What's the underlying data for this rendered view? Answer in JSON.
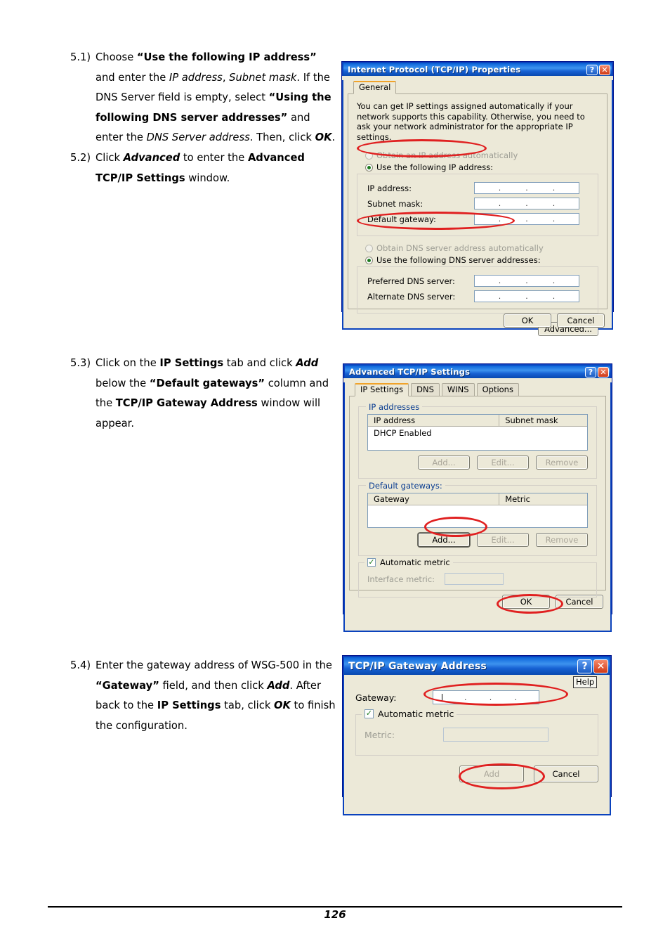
{
  "steps": [
    {
      "num": "5.1)",
      "id": "step-5-1",
      "segments": [
        {
          "t": "Choose ",
          "s": "n"
        },
        {
          "t": "“Use the following IP address”",
          "s": "b"
        },
        {
          "t": " and enter the ",
          "s": "n"
        },
        {
          "t": "IP address",
          "s": "i"
        },
        {
          "t": ", ",
          "s": "n"
        },
        {
          "t": "Subnet mask",
          "s": "i"
        },
        {
          "t": ". If the DNS Server field is empty, select ",
          "s": "n"
        },
        {
          "t": "“Using the following DNS server addresses”",
          "s": "b"
        },
        {
          "t": " and enter the ",
          "s": "n"
        },
        {
          "t": "DNS Server address",
          "s": "i"
        },
        {
          "t": ". Then, click ",
          "s": "n"
        },
        {
          "t": "OK",
          "s": "bi"
        },
        {
          "t": ".",
          "s": "n"
        }
      ]
    },
    {
      "num": "5.2)",
      "id": "step-5-2",
      "segments": [
        {
          "t": "Click ",
          "s": "n"
        },
        {
          "t": "Advanced",
          "s": "bi"
        },
        {
          "t": " to enter the ",
          "s": "n"
        },
        {
          "t": "Advanced TCP/IP Settings",
          "s": "b"
        },
        {
          "t": " window.",
          "s": "n"
        }
      ]
    },
    {
      "num": "5.3)",
      "id": "step-5-3",
      "segments": [
        {
          "t": "Click on the ",
          "s": "n"
        },
        {
          "t": "IP Settings",
          "s": "b"
        },
        {
          "t": " tab and click ",
          "s": "n"
        },
        {
          "t": "Add",
          "s": "bi"
        },
        {
          "t": " below the ",
          "s": "n"
        },
        {
          "t": "“Default gateways”",
          "s": "b"
        },
        {
          "t": " column and the ",
          "s": "n"
        },
        {
          "t": "TCP/IP Gateway Address",
          "s": "b"
        },
        {
          "t": " window will appear.",
          "s": "n"
        }
      ]
    },
    {
      "num": "5.4)",
      "id": "step-5-4",
      "segments": [
        {
          "t": "Enter the gateway address of WSG-500 in the ",
          "s": "n"
        },
        {
          "t": "“Gateway”",
          "s": "b"
        },
        {
          "t": " field, and then click ",
          "s": "n"
        },
        {
          "t": "Add",
          "s": "bi"
        },
        {
          "t": ". After back to the ",
          "s": "n"
        },
        {
          "t": "IP Settings",
          "s": "b"
        },
        {
          "t": " tab, click ",
          "s": "n"
        },
        {
          "t": "OK",
          "s": "bi"
        },
        {
          "t": " to finish the configuration.",
          "s": "n"
        }
      ]
    }
  ],
  "dialog1": {
    "title": "Internet Protocol (TCP/IP) Properties",
    "help_button": "?",
    "close_button": "✕",
    "tabs": [
      {
        "label": "General",
        "active": true
      }
    ],
    "description": "You can get IP settings assigned automatically if your network supports this capability. Otherwise, you need to ask your network administrator for the appropriate IP settings.",
    "radio_obtain_ip": "Obtain an IP address automatically",
    "radio_use_ip": "Use the following IP address:",
    "fields": [
      {
        "label": "IP address:",
        "value": ""
      },
      {
        "label": "Subnet mask:",
        "value": ""
      },
      {
        "label": "Default gateway:",
        "value": ""
      }
    ],
    "radio_obtain_dns": "Obtain DNS server address automatically",
    "radio_use_dns": "Use the following DNS server addresses:",
    "dns_fields": [
      {
        "label": "Preferred DNS server:",
        "value": ""
      },
      {
        "label": "Alternate DNS server:",
        "value": ""
      }
    ],
    "advanced_button": "Advanced...",
    "ok_button": "OK",
    "cancel_button": "Cancel"
  },
  "dialog2": {
    "title": "Advanced TCP/IP Settings",
    "help_button": "?",
    "close_button": "✕",
    "tabs": [
      {
        "label": "IP Settings",
        "active": true
      },
      {
        "label": "DNS",
        "active": false
      },
      {
        "label": "WINS",
        "active": false
      },
      {
        "label": "Options",
        "active": false
      }
    ],
    "ip_group_caption": "IP addresses",
    "ip_columns": [
      "IP address",
      "Subnet mask"
    ],
    "ip_rows": [
      [
        "DHCP Enabled",
        ""
      ]
    ],
    "ip_buttons": [
      "Add...",
      "Edit...",
      "Remove"
    ],
    "gw_group_caption": "Default gateways:",
    "gw_columns": [
      "Gateway",
      "Metric"
    ],
    "gw_rows": [],
    "gw_buttons": [
      "Add...",
      "Edit...",
      "Remove"
    ],
    "automatic_metric_label": "Automatic metric",
    "automatic_metric_checked": true,
    "interface_metric_label": "Interface metric:",
    "interface_metric_value": "",
    "ok_button": "OK",
    "cancel_button": "Cancel"
  },
  "dialog3": {
    "title": "TCP/IP Gateway Address",
    "help_button": "?",
    "close_button": "✕",
    "tooltip": "Help",
    "gateway_label": "Gateway:",
    "gateway_value": "",
    "automatic_metric_label": "Automatic metric",
    "automatic_metric_checked": true,
    "metric_label": "Metric:",
    "metric_value": "",
    "add_button": "Add",
    "cancel_button": "Cancel"
  },
  "footer": {
    "page_number": "126"
  },
  "colors": {
    "annotation": "#e02020",
    "titlebar_blue": "#1862d4",
    "dialog_face": "#ece9d8",
    "tab_accent": "#f0a32a"
  }
}
